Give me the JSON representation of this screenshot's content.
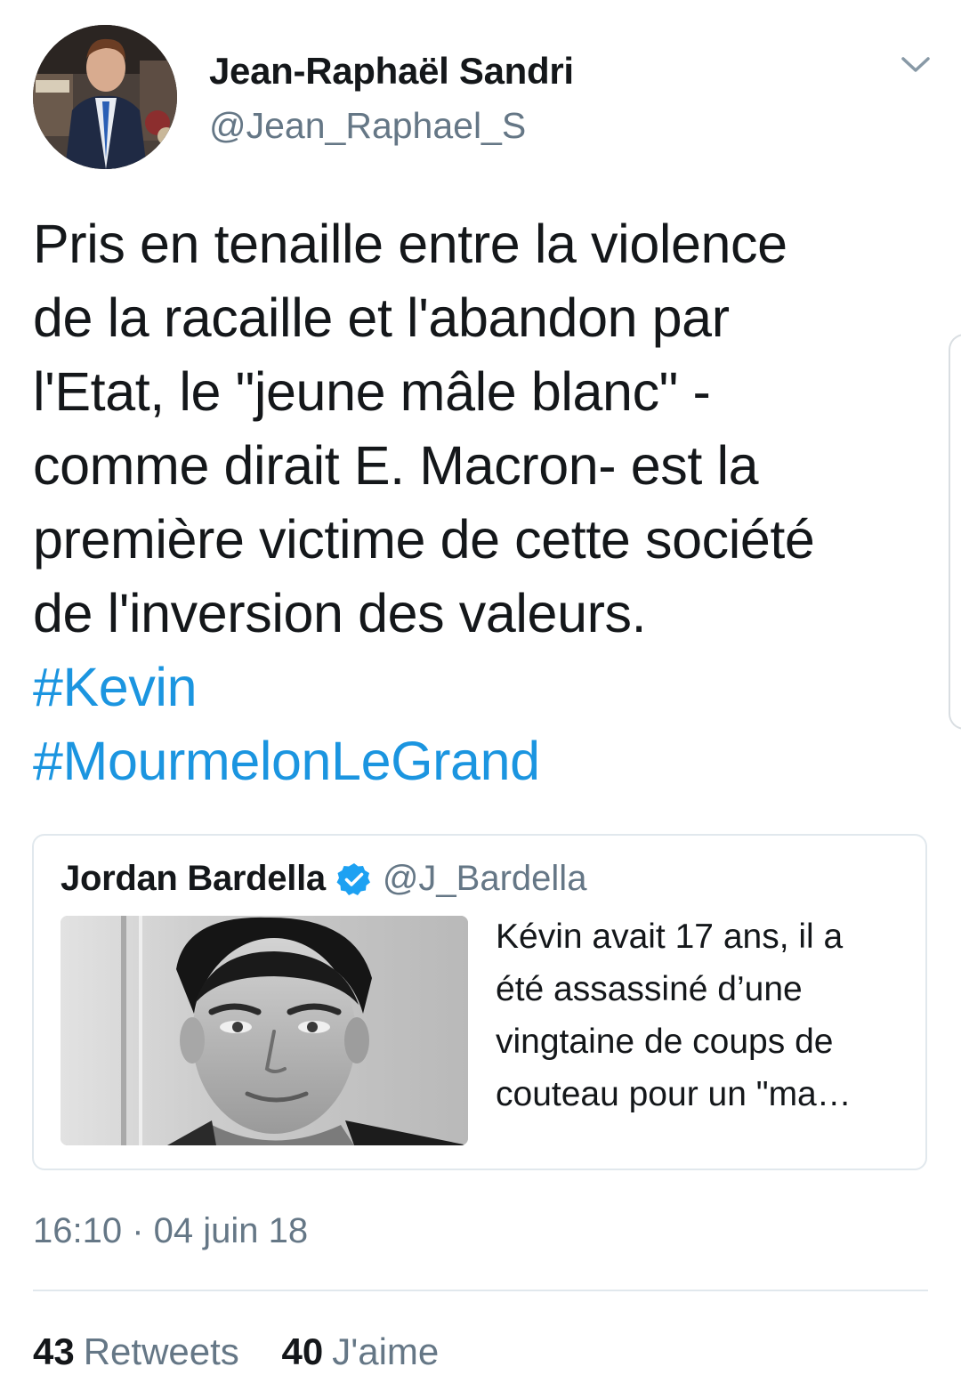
{
  "author": {
    "name": "Jean-Raphaël Sandri",
    "handle": "@Jean_Raphael_S"
  },
  "tweet": {
    "lines": [
      "Pris en tenaille entre la violence",
      "de la racaille et l'abandon par",
      "l'Etat, le \"jeune mâle blanc\" -",
      "comme dirait E. Macron- est la",
      "première victime de cette société",
      "de l'inversion des valeurs."
    ],
    "hashtags": [
      "#Kevin",
      "#MourmelonLeGrand"
    ]
  },
  "quoted_tweet": {
    "name": "Jordan Bardella",
    "handle": "@J_Bardella",
    "verified": true,
    "text_lines": [
      "Kévin avait 17 ans, il a",
      "été assassiné d’une",
      "vingtaine de coups de",
      "couteau pour un \"ma…"
    ]
  },
  "timestamp": "16:10 · 04 juin 18",
  "stats": {
    "retweets_count": "43",
    "retweets_label": "Retweets",
    "likes_count": "40",
    "likes_label": "J'aime"
  },
  "colors": {
    "text": "#14171a",
    "secondary": "#657786",
    "link": "#1b95e0",
    "border": "#e1e8ed",
    "verified": "#1da1f2"
  },
  "icons": {
    "menu": "chevron-down-icon",
    "verified": "verified-badge-icon"
  }
}
